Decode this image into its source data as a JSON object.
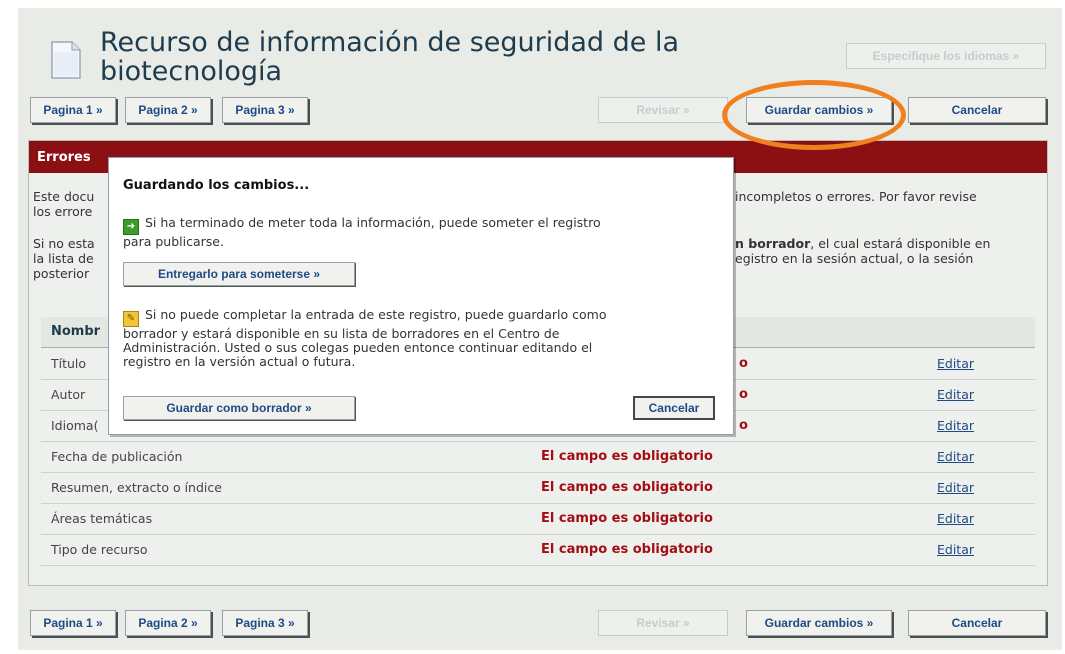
{
  "header": {
    "title_line1": "Recurso de información de seguridad de la",
    "title_line2": "biotecnología",
    "languages_button": "Especifique los idiomas »"
  },
  "toolbar": {
    "page1": "Pagina 1 »",
    "page2": "Pagina 2 »",
    "page3": "Pagina 3 »",
    "review": "Revisar »",
    "save": "Guardar cambios »",
    "cancel": "Cancelar"
  },
  "errors": {
    "heading": "Errores",
    "para1_left": "Este docu",
    "para1_left2": "los errore",
    "para1_right": "incompletos o errores. Por favor revise",
    "para2_left1": "Si no esta",
    "para2_left2": "la lista de",
    "para2_left3": "posterior",
    "para2_right_bold": "n borrador",
    "para2_right1": ", el cual estará disponible en",
    "para2_right2": "egistro en la sesión actual, o la sesión"
  },
  "table": {
    "col_name": "Nombr",
    "rows": [
      {
        "label": "Título",
        "msg": "o",
        "edit": "Editar"
      },
      {
        "label": "Autor",
        "msg": "o",
        "edit": "Editar"
      },
      {
        "label": "Idioma(",
        "msg": "o",
        "edit": "Editar"
      },
      {
        "label": "Fecha de publicación",
        "msg": "El campo es obligatorio",
        "edit": "Editar"
      },
      {
        "label": "Resumen, extracto o índice",
        "msg": "El campo es obligatorio",
        "edit": "Editar"
      },
      {
        "label": "Áreas temáticas",
        "msg": "El campo es obligatorio",
        "edit": "Editar"
      },
      {
        "label": "Tipo de recurso",
        "msg": "El campo es obligatorio",
        "edit": "Editar"
      }
    ]
  },
  "modal": {
    "title": "Guardando los cambios...",
    "submit_text_1": "Si ha terminado de meter toda la información, puede someter el registro",
    "submit_text_2": "para publicarse.",
    "submit_button": "Entregarlo para someterse »",
    "draft_text_1": "Si no puede completar la entrada de este registro, puede guardarlo como",
    "draft_text_2": "borrador y estará disponible en su lista de borradores en el Centro de",
    "draft_text_3": "Administración. Usted o sus colegas pueden entonce continuar editando el",
    "draft_text_4": "registro en la versión actual o futura.",
    "draft_button": "Guardar como borrador »",
    "cancel_button": "Cancelar"
  },
  "colors": {
    "error_header": "#8c0f14",
    "error_text": "#a40d12",
    "highlight_ring": "#f07f1e",
    "link": "#1f4a86"
  }
}
